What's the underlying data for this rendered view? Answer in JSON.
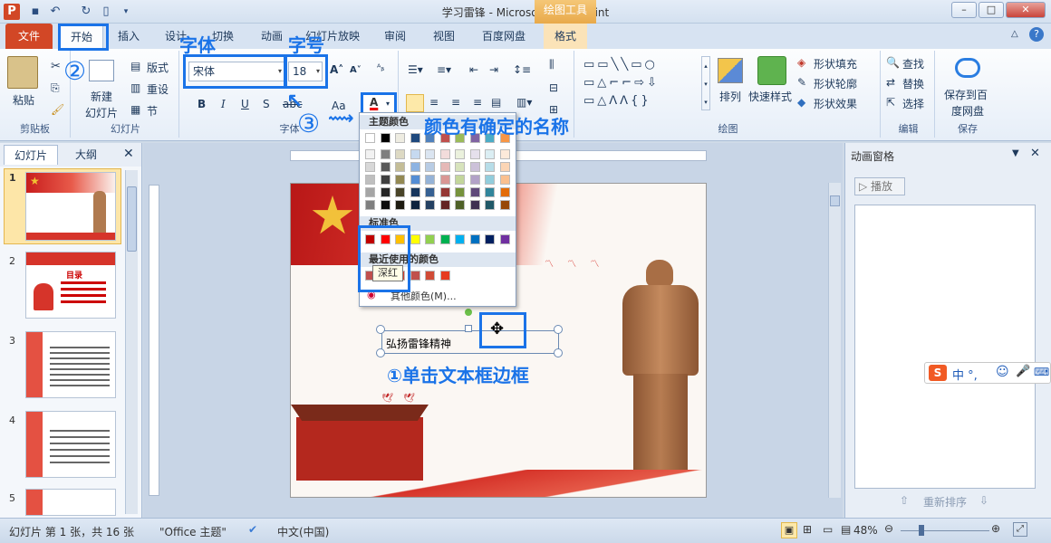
{
  "window": {
    "title": "学习雷锋 - Microsoft PowerPoint",
    "context_tab": "绘图工具"
  },
  "tabs": [
    "文件",
    "开始",
    "插入",
    "设计",
    "切换",
    "动画",
    "幻灯片放映",
    "审阅",
    "视图",
    "百度网盘",
    "格式"
  ],
  "ribbon": {
    "clipboard": {
      "paste": "粘贴",
      "group": "剪贴板"
    },
    "slides": {
      "new_slide_1": "新建",
      "new_slide_2": "幻灯片",
      "layout": "版式",
      "reset": "重设",
      "section": "节",
      "group": "幻灯片"
    },
    "font": {
      "font_name": "宋体",
      "font_size": "18",
      "bold": "B",
      "italic": "I",
      "underline": "U",
      "strike": "S",
      "aa": "Aa",
      "font_color_letter": "A",
      "group": "字体"
    },
    "paragraph": {
      "group": "段落"
    },
    "drawing": {
      "arrange": "排列",
      "quick_styles": "快速样式",
      "shape_fill": "形状填充",
      "shape_outline": "形状轮廓",
      "shape_effect": "形状效果",
      "group": "绘图"
    },
    "editing": {
      "find": "查找",
      "replace": "替换",
      "select": "选择",
      "group": "编辑"
    },
    "save": {
      "label_1": "保存到百",
      "label_2": "度网盘",
      "group": "保存"
    }
  },
  "color_picker": {
    "theme_header": "主题颜色",
    "standard_header": "标准色",
    "recent_header": "最近使用的颜色",
    "tooltip": "深红",
    "more_colors": "其他颜色(M)...",
    "theme_top": [
      "#ffffff",
      "#000000",
      "#eeece1",
      "#1f497d",
      "#4f81bd",
      "#c0504d",
      "#9bbb59",
      "#8064a2",
      "#4bacc6",
      "#f79646"
    ],
    "theme_cols": [
      [
        "#f2f2f2",
        "#d8d8d8",
        "#bfbfbf",
        "#a5a5a5",
        "#7f7f7f"
      ],
      [
        "#7f7f7f",
        "#595959",
        "#3f3f3f",
        "#262626",
        "#0c0c0c"
      ],
      [
        "#ddd9c3",
        "#c4bd97",
        "#938953",
        "#494429",
        "#1d1b10"
      ],
      [
        "#c6d9f0",
        "#8db3e2",
        "#548dd4",
        "#17365d",
        "#0f243e"
      ],
      [
        "#dbe5f1",
        "#b8cce4",
        "#95b3d7",
        "#366092",
        "#244061"
      ],
      [
        "#f2dcdb",
        "#e5b9b7",
        "#d99694",
        "#953734",
        "#632423"
      ],
      [
        "#ebf1dd",
        "#d7e3bc",
        "#c3d69b",
        "#76923c",
        "#4f6128"
      ],
      [
        "#e5e0ec",
        "#ccc1d9",
        "#b2a2c7",
        "#5f497a",
        "#3f3151"
      ],
      [
        "#dbeef3",
        "#b7dde8",
        "#92cddc",
        "#31859b",
        "#205867"
      ],
      [
        "#fdeada",
        "#fbd5b5",
        "#fac08f",
        "#e36c09",
        "#974806"
      ]
    ],
    "standard": [
      "#c00000",
      "#ff0000",
      "#ffc000",
      "#ffff00",
      "#92d050",
      "#00b050",
      "#00b0f0",
      "#0070c0",
      "#002060",
      "#7030a0"
    ],
    "recent": [
      "#c0504d",
      "#e04a3a",
      "#d9412e",
      "#c0504d",
      "#d04b36",
      "#e63b1f"
    ]
  },
  "left_pane": {
    "tab_slides": "幻灯片",
    "tab_outline": "大纲",
    "slide_numbers": [
      "1",
      "2",
      "3",
      "4",
      "5"
    ],
    "thumb2_title": "目录"
  },
  "slide": {
    "textbox_text": "弘扬雷锋精神"
  },
  "anim_pane": {
    "title": "动画窗格",
    "play": "播放",
    "reorder": "重新排序"
  },
  "status": {
    "slide_info": "幻灯片 第 1 张，共 16 张",
    "theme": "\"Office 主题\"",
    "language": "中文(中国)",
    "zoom": "48%"
  },
  "ime": {
    "label": "中 °,"
  },
  "annotations": {
    "font_label": "字体",
    "size_label": "字号",
    "num2": "②",
    "num3": "③",
    "color_note": "颜色有确定的名称",
    "step1": "①单击文本框边框"
  }
}
